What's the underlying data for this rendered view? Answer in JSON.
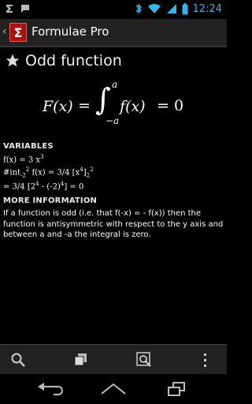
{
  "status": {
    "time": "12:24"
  },
  "app": {
    "title": "Formulae Pro"
  },
  "page": {
    "title": "Odd function",
    "formula": {
      "lhs": "F(x)",
      "eq": "=",
      "upper": "a",
      "lower": "−a",
      "integrand": "f(x)",
      "rhs": "= 0"
    },
    "variables_heading": "VARIABLES",
    "variables": {
      "l1_a": "f(x) = 3 x",
      "l1_sup": "3",
      "l2_a": "#int",
      "l2_sub1": "-2",
      "l2_sup1": "2",
      "l2_b": " f(x) = 3/4 [x",
      "l2_sup2": "4",
      "l2_c": "]",
      "l2_sub2": "2",
      "l2_sup3": "2",
      "l3_a": "= 3/4 [2",
      "l3_sup1": "4",
      "l3_b": " - (-2)",
      "l3_sup2": "4",
      "l3_c": "] = 0"
    },
    "more_heading": "MORE INFORMATION",
    "more_text": "If a function is odd (i.e. that f(-x) = - f(x)) then the function is antisymmetric with respect to the y axis and between a and -a the integral is zero."
  },
  "toolbar": {
    "icons": [
      "search-icon",
      "copy-icon",
      "search-in-page-icon",
      "overflow-menu-icon"
    ]
  },
  "nav": {
    "icons": [
      "back-icon",
      "home-icon",
      "recent-apps-icon"
    ]
  }
}
